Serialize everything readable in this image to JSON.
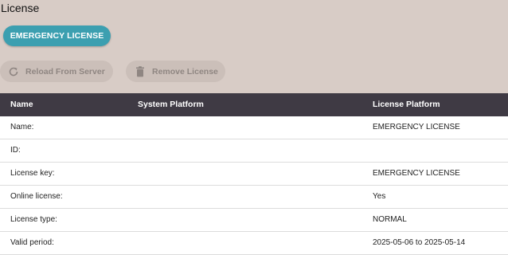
{
  "page": {
    "title": "License"
  },
  "actions": {
    "emergency_label": "EMERGENCY LICENSE",
    "reload_label": "Reload From Server",
    "remove_label": "Remove License"
  },
  "table": {
    "headers": [
      "Name",
      "System Platform",
      "License Platform"
    ],
    "rows": [
      {
        "label": "Name:",
        "system": "",
        "license": "EMERGENCY LICENSE"
      },
      {
        "label": "ID:",
        "system": "",
        "license": ""
      },
      {
        "label": "License key:",
        "system": "",
        "license": "EMERGENCY LICENSE"
      },
      {
        "label": "Online license:",
        "system": "",
        "license": "Yes"
      },
      {
        "label": "License type:",
        "system": "",
        "license": "NORMAL"
      },
      {
        "label": "Valid period:",
        "system": "",
        "license": "2025-05-06 to 2025-05-14"
      }
    ]
  },
  "icons": {
    "reload": "reload-icon",
    "remove": "trash-icon"
  },
  "colors": {
    "accent": "#3c9fb0",
    "header_bg": "#3f3a44",
    "page_bg": "#d8ccc6"
  }
}
